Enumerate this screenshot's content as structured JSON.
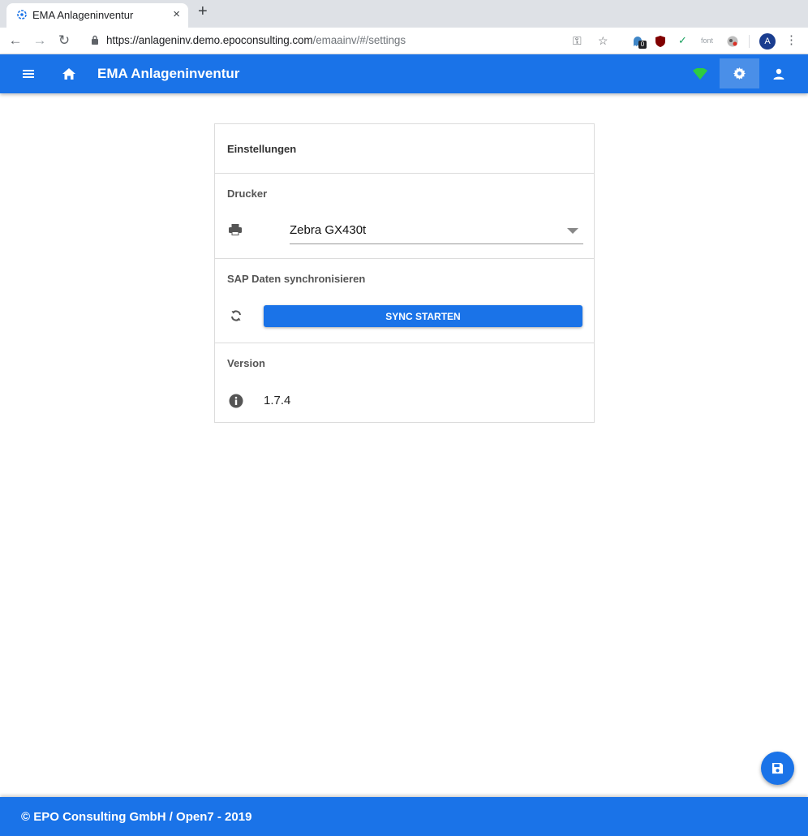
{
  "browser": {
    "tab_title": "EMA Anlageninventur",
    "tab_close": "×",
    "new_tab": "+",
    "url_host": "https://anlageninv.demo.epoconsulting.com",
    "url_path": "/emaainv/#/settings",
    "extension_badge": "0",
    "extension_font_label": "font",
    "profile_initial": "A",
    "menu": "⋮"
  },
  "appbar": {
    "title": "EMA Anlageninventur",
    "color": "#1a73e8",
    "connection_status_color": "#2ecc40"
  },
  "settings": {
    "title": "Einstellungen",
    "printer": {
      "label": "Drucker",
      "selected": "Zebra GX430t"
    },
    "sync": {
      "label": "SAP Daten synchronisieren",
      "button": "SYNC STARTEN"
    },
    "version": {
      "label": "Version",
      "value": "1.7.4"
    }
  },
  "footer": {
    "text": "© EPO Consulting GmbH / Open7 - 2019"
  }
}
